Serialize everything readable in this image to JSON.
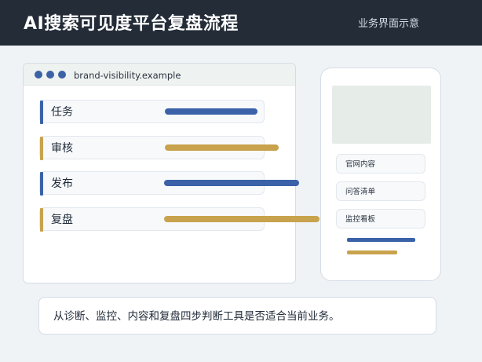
{
  "header": {
    "title": "AI搜索可见度平台复盘流程",
    "subtitle": "业务界面示意"
  },
  "browser": {
    "url": "brand-visibility.example",
    "steps": [
      {
        "label": "任务",
        "accent": "#3b62a8",
        "bar_color": "#3b62a8"
      },
      {
        "label": "审核",
        "accent": "#c8a24d",
        "bar_color": "#c8a24d"
      },
      {
        "label": "发布",
        "accent": "#3b62a8",
        "bar_color": "#3b62a8"
      },
      {
        "label": "复盘",
        "accent": "#c8a24d",
        "bar_color": "#c8a24d"
      }
    ]
  },
  "phone": {
    "items": [
      {
        "label": "官网内容"
      },
      {
        "label": "问答清单"
      },
      {
        "label": "监控看板"
      }
    ]
  },
  "note": {
    "text": "从诊断、监控、内容和复盘四步判断工具是否适合当前业务。"
  },
  "colors": {
    "blue": "#3b62a8",
    "gold": "#c8a24d",
    "header_bg": "#232c37"
  }
}
